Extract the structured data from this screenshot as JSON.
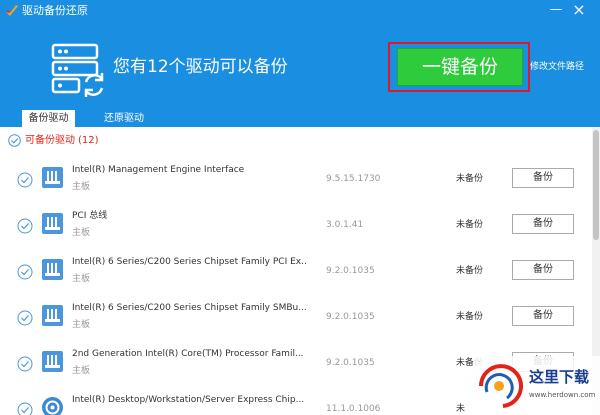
{
  "window": {
    "title": "驱动备份还原",
    "minimize": "—",
    "close": "×"
  },
  "hero": {
    "message": "您有12个驱动可以备份",
    "backup_all": "一键备份",
    "change_path": "修改文件路径"
  },
  "tabs": [
    {
      "label": "备份驱动",
      "active": true
    },
    {
      "label": "还原驱动",
      "active": false
    }
  ],
  "section": {
    "label": "可备份驱动",
    "count": "(12)"
  },
  "drivers": [
    {
      "name": "Intel(R) Management Engine Interface",
      "category": "主板",
      "version": "9.5.15.1730",
      "status": "未备份",
      "action": "备份",
      "icon": "chip-icon"
    },
    {
      "name": "PCI 总线",
      "category": "主板",
      "version": "3.0.1.41",
      "status": "未备份",
      "action": "备份",
      "icon": "chip-icon"
    },
    {
      "name": "Intel(R) 6 Series/C200 Series Chipset Family PCI Ex...",
      "category": "主板",
      "version": "9.2.0.1035",
      "status": "未备份",
      "action": "备份",
      "icon": "chip-icon"
    },
    {
      "name": "Intel(R) 6 Series/C200 Series Chipset Family SMBu...",
      "category": "主板",
      "version": "9.2.0.1035",
      "status": "未备份",
      "action": "备份",
      "icon": "chip-icon"
    },
    {
      "name": "2nd Generation Intel(R) Core(TM) Processor Famil...",
      "category": "主板",
      "version": "9.2.0.1035",
      "status": "未备份",
      "action": "备份",
      "icon": "chip-icon"
    },
    {
      "name": "Intel(R) Desktop/Workstation/Server Express Chip...",
      "category": "",
      "version": "11.1.0.1006",
      "status": "未",
      "action": "",
      "icon": "disc-icon"
    }
  ],
  "watermark": {
    "name": "这里下载",
    "url": "www.herdown.com"
  },
  "colors": {
    "header": "#1a8ee0",
    "backup_button": "#2ecb3c",
    "highlight_frame": "#e0182a",
    "section_red": "#e2231a",
    "driver_icon": "#4c96dc"
  }
}
